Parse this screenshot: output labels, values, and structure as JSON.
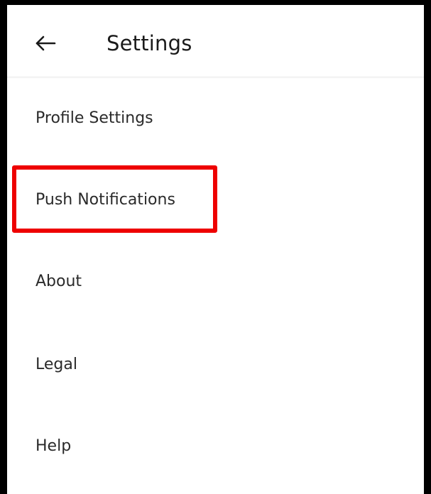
{
  "header": {
    "back_icon": "arrow-left-icon",
    "title": "Settings"
  },
  "menu": {
    "items": [
      {
        "label": "Profile Settings"
      },
      {
        "label": "Push Notifications",
        "highlighted": true
      },
      {
        "label": "About"
      },
      {
        "label": "Legal"
      },
      {
        "label": "Help"
      }
    ]
  },
  "colors": {
    "highlight_border": "#ee0000",
    "frame_border": "#000000",
    "text": "#2a2a2a"
  }
}
